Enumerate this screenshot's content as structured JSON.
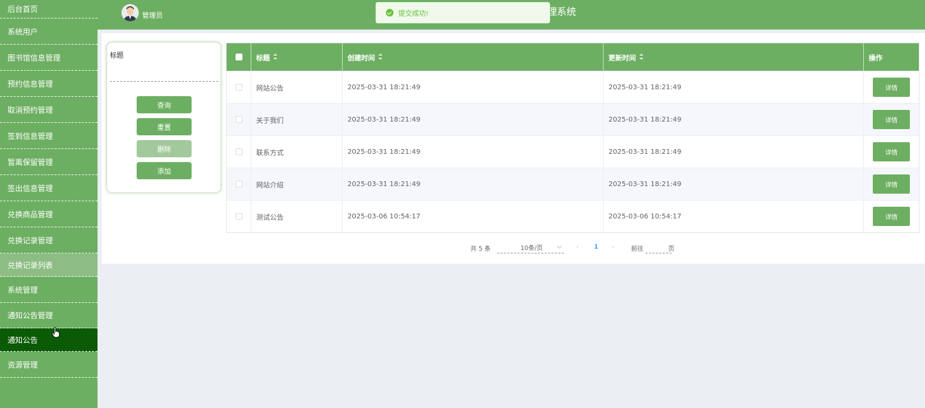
{
  "sidebar": {
    "items": [
      {
        "label": "后台首页"
      },
      {
        "label": "系统用户"
      },
      {
        "label": "图书馆信息管理"
      },
      {
        "label": "预约信息管理"
      },
      {
        "label": "取消预约管理"
      },
      {
        "label": "签到信息管理"
      },
      {
        "label": "暂离保留管理"
      },
      {
        "label": "签出信息管理"
      },
      {
        "label": "兑换商品管理"
      },
      {
        "label": "兑换记录管理"
      },
      {
        "label": "兑换记录列表"
      },
      {
        "label": "系统管理"
      },
      {
        "label": "通知公告管理"
      },
      {
        "label": "通知公告"
      },
      {
        "label": "资源管理"
      }
    ]
  },
  "header": {
    "user_name": "管理员",
    "system_title_visible": "理系统"
  },
  "toast": {
    "message": "提交成功!"
  },
  "search": {
    "label": "标题",
    "input_value": "",
    "buttons": {
      "query": "查询",
      "reset": "重置",
      "delete": "删除",
      "add": "添加"
    }
  },
  "table": {
    "columns": [
      "标题",
      "创建时间",
      "更新时间",
      "操作"
    ],
    "rows": [
      {
        "title": "网站公告",
        "created": "2025-03-31 18:21:49",
        "updated": "2025-03-31 18:21:49",
        "action": "详情"
      },
      {
        "title": "关于我们",
        "created": "2025-03-31 18:21:49",
        "updated": "2025-03-31 18:21:49",
        "action": "详情"
      },
      {
        "title": "联系方式",
        "created": "2025-03-31 18:21:49",
        "updated": "2025-03-31 18:21:49",
        "action": "详情"
      },
      {
        "title": "网站介绍",
        "created": "2025-03-31 18:21:49",
        "updated": "2025-03-31 18:21:49",
        "action": "详情"
      },
      {
        "title": "测试公告",
        "created": "2025-03-06 10:54:17",
        "updated": "2025-03-06 10:54:17",
        "action": "详情"
      }
    ]
  },
  "pagination": {
    "total_text": "共 5 条",
    "page_size": "10条/页",
    "prev": "‹",
    "current": "1",
    "next": "›",
    "goto_label": "前往",
    "goto_value": "",
    "goto_unit": "页"
  },
  "colors": {
    "brand": "#6daf62",
    "active": "#0a5a06",
    "sub_item": "#8dbd84",
    "success": "#67c23a",
    "page_active": "#409eff"
  }
}
